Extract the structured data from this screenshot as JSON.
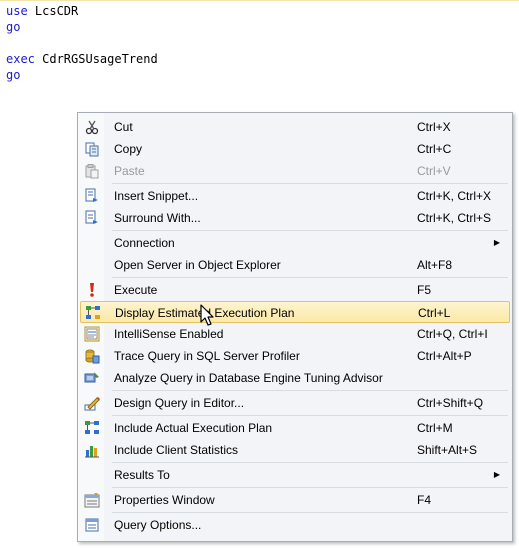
{
  "editor": {
    "line1_kw": "use",
    "line1_rest": " LcsCDR",
    "line2": "go",
    "line4_kw": "exec",
    "line4_rest": " CdrRGSUsageTrend",
    "line5": "go"
  },
  "menu": {
    "cut": {
      "label": "Cut",
      "shortcut": "Ctrl+X",
      "icon": "scissors-icon"
    },
    "copy": {
      "label": "Copy",
      "shortcut": "Ctrl+C",
      "icon": "copy-icon"
    },
    "paste": {
      "label": "Paste",
      "shortcut": "Ctrl+V",
      "icon": "paste-icon"
    },
    "insert_snippet": {
      "label": "Insert Snippet...",
      "shortcut": "Ctrl+K, Ctrl+X",
      "icon": "snippet-icon"
    },
    "surround_with": {
      "label": "Surround With...",
      "shortcut": "Ctrl+K, Ctrl+S",
      "icon": "surround-icon"
    },
    "connection": {
      "label": "Connection",
      "submenu_arrow": "▶"
    },
    "open_server": {
      "label": "Open Server in Object Explorer",
      "shortcut": "Alt+F8"
    },
    "execute": {
      "label": "Execute",
      "shortcut": "F5",
      "icon": "exclamation-icon"
    },
    "display_plan": {
      "label": "Display Estimated Execution Plan",
      "shortcut": "Ctrl+L",
      "icon": "estimated-plan-icon"
    },
    "intellisense": {
      "label": "IntelliSense Enabled",
      "shortcut": "Ctrl+Q, Ctrl+I",
      "icon": "intellisense-icon"
    },
    "trace_query": {
      "label": "Trace Query in SQL Server Profiler",
      "shortcut": "Ctrl+Alt+P",
      "icon": "profiler-icon"
    },
    "analyze_query": {
      "label": "Analyze Query in Database Engine Tuning Advisor",
      "icon": "tuning-advisor-icon"
    },
    "design_query": {
      "label": "Design Query in Editor...",
      "shortcut": "Ctrl+Shift+Q",
      "icon": "design-query-icon"
    },
    "actual_plan": {
      "label": "Include Actual Execution Plan",
      "shortcut": "Ctrl+M",
      "icon": "actual-plan-icon"
    },
    "client_stats": {
      "label": "Include Client Statistics",
      "shortcut": "Shift+Alt+S",
      "icon": "client-stats-icon"
    },
    "results_to": {
      "label": "Results To",
      "submenu_arrow": "▶"
    },
    "properties": {
      "label": "Properties Window",
      "shortcut": "F4",
      "icon": "properties-icon"
    },
    "query_options": {
      "label": "Query Options...",
      "icon": "query-options-icon"
    }
  }
}
